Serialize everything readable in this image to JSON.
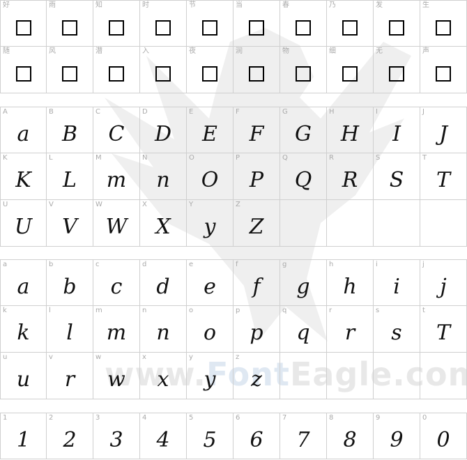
{
  "cjk": [
    {
      "label": "好",
      "glyph": ""
    },
    {
      "label": "雨",
      "glyph": ""
    },
    {
      "label": "知",
      "glyph": ""
    },
    {
      "label": "时",
      "glyph": ""
    },
    {
      "label": "节",
      "glyph": ""
    },
    {
      "label": "当",
      "glyph": ""
    },
    {
      "label": "春",
      "glyph": ""
    },
    {
      "label": "乃",
      "glyph": ""
    },
    {
      "label": "发",
      "glyph": ""
    },
    {
      "label": "生",
      "glyph": ""
    },
    {
      "label": "随",
      "glyph": ""
    },
    {
      "label": "风",
      "glyph": ""
    },
    {
      "label": "潜",
      "glyph": ""
    },
    {
      "label": "入",
      "glyph": ""
    },
    {
      "label": "夜",
      "glyph": ""
    },
    {
      "label": "润",
      "glyph": ""
    },
    {
      "label": "物",
      "glyph": ""
    },
    {
      "label": "细",
      "glyph": ""
    },
    {
      "label": "无",
      "glyph": ""
    },
    {
      "label": "声",
      "glyph": ""
    }
  ],
  "upper": [
    {
      "label": "A",
      "glyph": "a"
    },
    {
      "label": "B",
      "glyph": "B"
    },
    {
      "label": "C",
      "glyph": "C"
    },
    {
      "label": "D",
      "glyph": "D"
    },
    {
      "label": "E",
      "glyph": "E"
    },
    {
      "label": "F",
      "glyph": "F"
    },
    {
      "label": "G",
      "glyph": "G"
    },
    {
      "label": "H",
      "glyph": "H"
    },
    {
      "label": "I",
      "glyph": "I"
    },
    {
      "label": "J",
      "glyph": "J"
    },
    {
      "label": "K",
      "glyph": "K"
    },
    {
      "label": "L",
      "glyph": "L"
    },
    {
      "label": "M",
      "glyph": "m"
    },
    {
      "label": "N",
      "glyph": "n"
    },
    {
      "label": "O",
      "glyph": "O"
    },
    {
      "label": "P",
      "glyph": "P"
    },
    {
      "label": "Q",
      "glyph": "Q"
    },
    {
      "label": "R",
      "glyph": "R"
    },
    {
      "label": "S",
      "glyph": "S"
    },
    {
      "label": "T",
      "glyph": "T"
    },
    {
      "label": "U",
      "glyph": "U"
    },
    {
      "label": "V",
      "glyph": "V"
    },
    {
      "label": "W",
      "glyph": "W"
    },
    {
      "label": "X",
      "glyph": "X"
    },
    {
      "label": "Y",
      "glyph": "y"
    },
    {
      "label": "Z",
      "glyph": "Z"
    },
    {
      "label": "",
      "glyph": ""
    },
    {
      "label": "",
      "glyph": ""
    },
    {
      "label": "",
      "glyph": ""
    },
    {
      "label": "",
      "glyph": ""
    }
  ],
  "lower": [
    {
      "label": "a",
      "glyph": "a"
    },
    {
      "label": "b",
      "glyph": "b"
    },
    {
      "label": "c",
      "glyph": "c"
    },
    {
      "label": "d",
      "glyph": "d"
    },
    {
      "label": "e",
      "glyph": "e"
    },
    {
      "label": "f",
      "glyph": "f"
    },
    {
      "label": "g",
      "glyph": "g"
    },
    {
      "label": "h",
      "glyph": "h"
    },
    {
      "label": "i",
      "glyph": "i"
    },
    {
      "label": "j",
      "glyph": "j"
    },
    {
      "label": "k",
      "glyph": "k"
    },
    {
      "label": "l",
      "glyph": "l"
    },
    {
      "label": "m",
      "glyph": "m"
    },
    {
      "label": "n",
      "glyph": "n"
    },
    {
      "label": "o",
      "glyph": "o"
    },
    {
      "label": "p",
      "glyph": "p"
    },
    {
      "label": "q",
      "glyph": "q"
    },
    {
      "label": "r",
      "glyph": "r"
    },
    {
      "label": "s",
      "glyph": "s"
    },
    {
      "label": "t",
      "glyph": "T"
    },
    {
      "label": "u",
      "glyph": "u"
    },
    {
      "label": "v",
      "glyph": "r"
    },
    {
      "label": "w",
      "glyph": "w"
    },
    {
      "label": "x",
      "glyph": "x"
    },
    {
      "label": "y",
      "glyph": "y"
    },
    {
      "label": "z",
      "glyph": "z"
    },
    {
      "label": "",
      "glyph": ""
    },
    {
      "label": "",
      "glyph": ""
    },
    {
      "label": "",
      "glyph": ""
    },
    {
      "label": "",
      "glyph": ""
    }
  ],
  "digits": [
    {
      "label": "1",
      "glyph": "1"
    },
    {
      "label": "2",
      "glyph": "2"
    },
    {
      "label": "3",
      "glyph": "3"
    },
    {
      "label": "4",
      "glyph": "4"
    },
    {
      "label": "5",
      "glyph": "5"
    },
    {
      "label": "6",
      "glyph": "6"
    },
    {
      "label": "7",
      "glyph": "7"
    },
    {
      "label": "8",
      "glyph": "8"
    },
    {
      "label": "9",
      "glyph": "9"
    },
    {
      "label": "0",
      "glyph": "0"
    }
  ],
  "watermark": {
    "part1": "www.",
    "part2": "Font",
    "part3": "Eagle.com"
  }
}
